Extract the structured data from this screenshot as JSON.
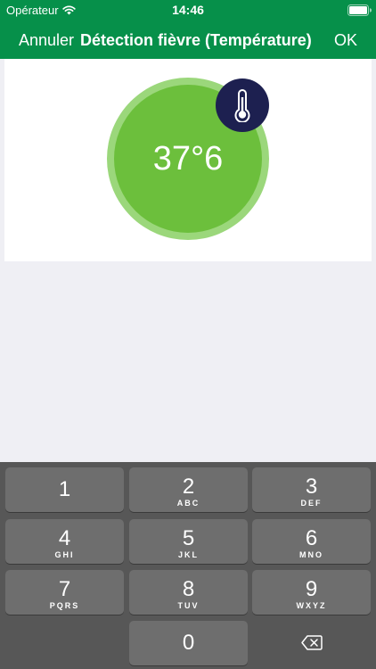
{
  "status_bar": {
    "carrier": "Opérateur",
    "time": "14:46",
    "wifi_icon": "wifi-icon",
    "battery_icon": "battery-icon",
    "battery_level": 1.0
  },
  "nav": {
    "cancel_label": "Annuler",
    "title": "Détection fièvre (Température)",
    "ok_label": "OK"
  },
  "temperature": {
    "value": "37°6",
    "icon": "thermometer-icon",
    "ring_color": "#9bd77b",
    "disc_color": "#6cbf3c",
    "badge_color": "#1d2050"
  },
  "colors": {
    "brand": "#06904a",
    "background": "#efeff4",
    "keyboard": "#575757",
    "key": "#6e6e6e"
  },
  "keypad": {
    "keys": [
      {
        "digit": "1",
        "letters": ""
      },
      {
        "digit": "2",
        "letters": "ABC"
      },
      {
        "digit": "3",
        "letters": "DEF"
      },
      {
        "digit": "4",
        "letters": "GHI"
      },
      {
        "digit": "5",
        "letters": "JKL"
      },
      {
        "digit": "6",
        "letters": "MNO"
      },
      {
        "digit": "7",
        "letters": "PQRS"
      },
      {
        "digit": "8",
        "letters": "TUV"
      },
      {
        "digit": "9",
        "letters": "WXYZ"
      },
      {
        "digit": "0",
        "letters": ""
      }
    ],
    "delete_icon": "backspace-icon"
  }
}
